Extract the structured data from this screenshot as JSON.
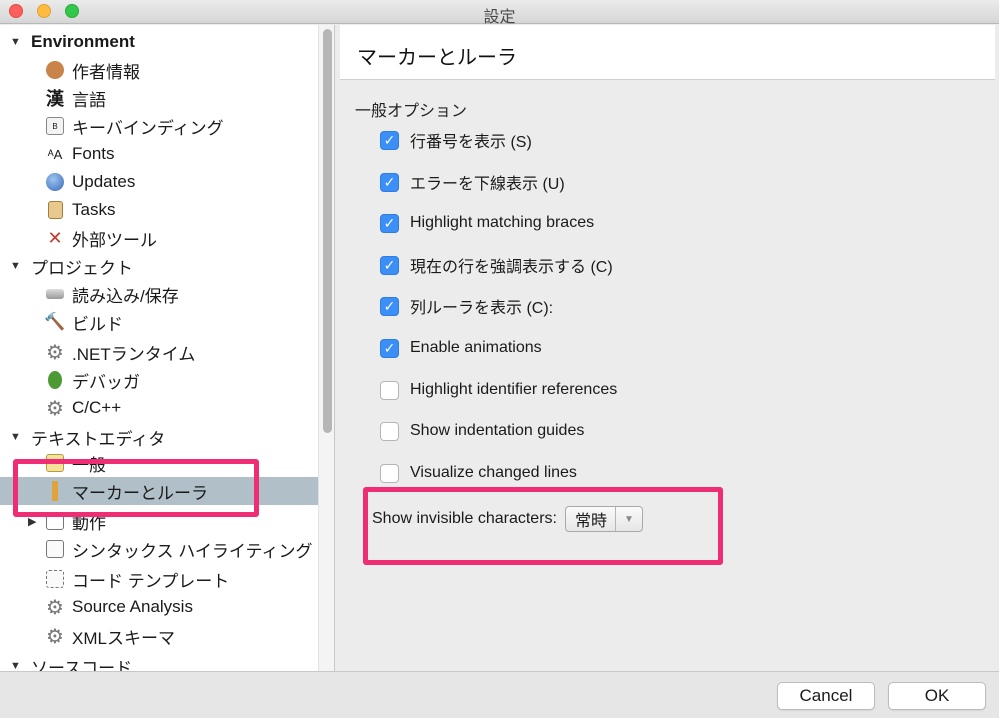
{
  "window": {
    "title": "設定"
  },
  "sidebar": {
    "environment": {
      "label": "Environment"
    },
    "env_items": [
      "作者情報",
      "言語",
      "キーバインディング",
      "Fonts",
      "Updates",
      "Tasks",
      "外部ツール"
    ],
    "project": {
      "label": "プロジェクト"
    },
    "project_items": [
      "読み込み/保存",
      "ビルド",
      ".NETランタイム",
      "デバッガ",
      "C/C++"
    ],
    "text_editor": {
      "label": "テキストエディタ"
    },
    "editor_items": [
      "一般",
      "マーカーとルーラ",
      "動作",
      "シンタックス ハイライティング",
      "コード テンプレート",
      "Source Analysis",
      "XMLスキーマ"
    ],
    "source_code": {
      "label": "ソースコード"
    }
  },
  "panel": {
    "title": "マーカーとルーラ",
    "section": "一般オプション",
    "options": [
      {
        "label": "行番号を表示 (S)",
        "checked": true
      },
      {
        "label": "エラーを下線表示 (U)",
        "checked": true
      },
      {
        "label": "Highlight matching braces",
        "checked": true
      },
      {
        "label": "現在の行を強調表示する (C)",
        "checked": true
      },
      {
        "label": "列ルーラを表示 (C):",
        "checked": true
      },
      {
        "label": "Enable animations",
        "checked": true
      },
      {
        "label": "Highlight identifier references",
        "checked": false
      },
      {
        "label": "Show indentation guides",
        "checked": false
      },
      {
        "label": "Visualize changed lines",
        "checked": false
      }
    ],
    "invisible_label": "Show invisible characters:",
    "invisible_value": "常時"
  },
  "footer": {
    "cancel": "Cancel",
    "ok": "OK"
  },
  "colors": {
    "accent": "#3b8ff6",
    "highlight": "#ef2d74",
    "selection": "#b0bfc8"
  }
}
